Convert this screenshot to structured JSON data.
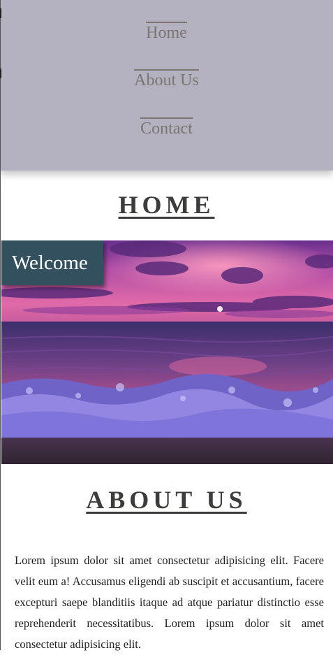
{
  "nav": {
    "items": [
      {
        "label": "Home"
      },
      {
        "label": "About Us"
      },
      {
        "label": "Contact"
      }
    ]
  },
  "home": {
    "title": "HOME",
    "welcome": "Welcome"
  },
  "about": {
    "title": "ABOUT US",
    "text": "Lorem ipsum dolor sit amet consectetur adipisicing elit. Facere velit eum a! Accusamus eligendi ab suscipit et accusantium, facere excepturi saepe blanditiis itaque ad atque pariatur distinctio esse reprehenderit necessitatibus. Lorem ipsum dolor sit amet consectetur adipisicing elit."
  },
  "colors": {
    "nav_bg": "#b4b2c1",
    "nav_link": "#7b7571",
    "heading": "#3c3c3a",
    "welcome_bg": "#33505f"
  }
}
